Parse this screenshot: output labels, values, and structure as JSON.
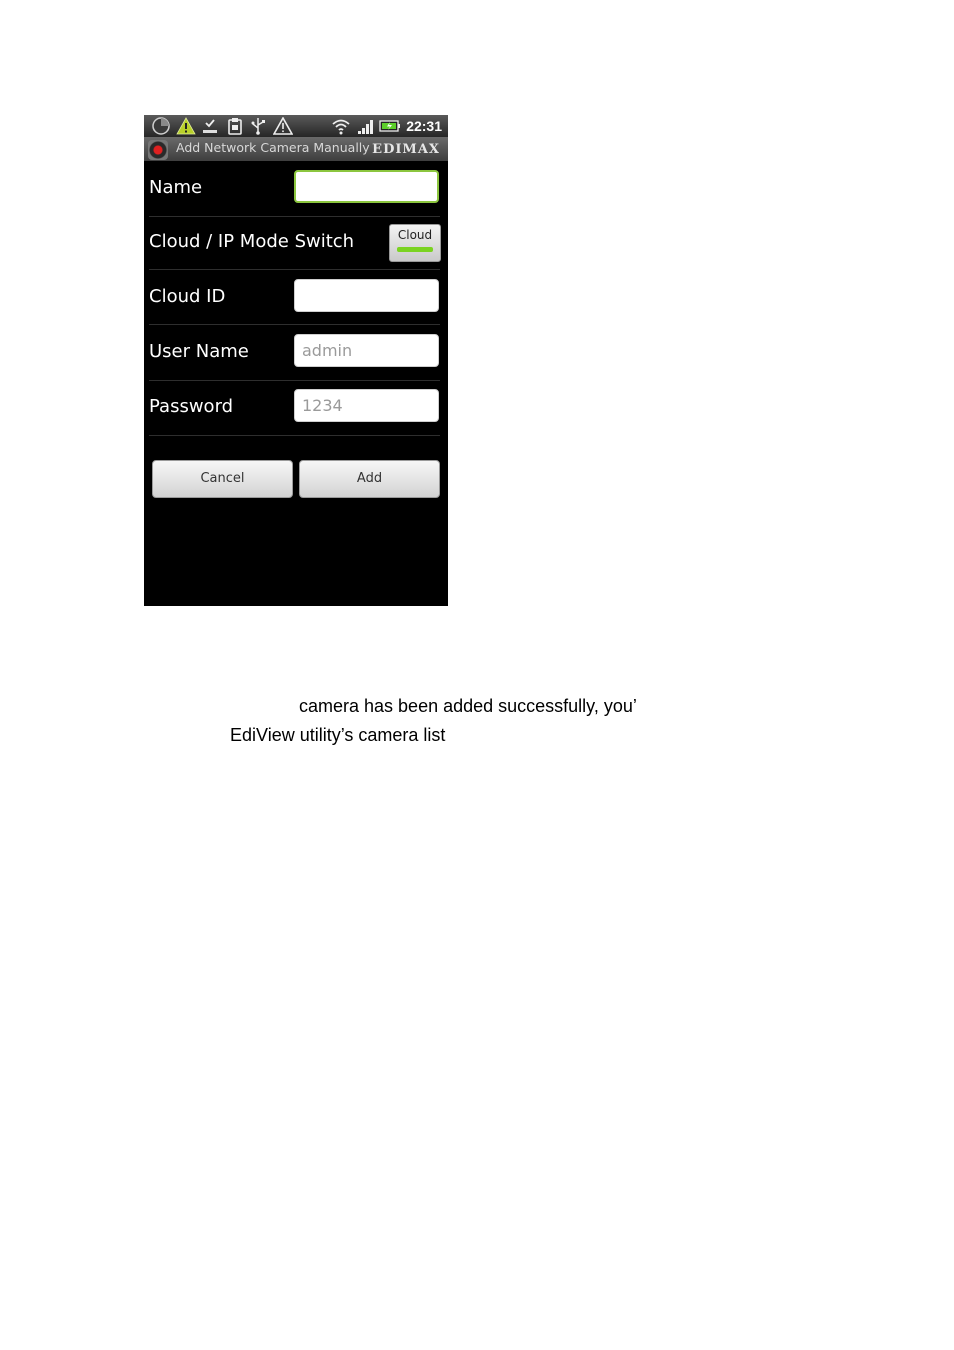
{
  "status_bar": {
    "time": "22:31",
    "icons": [
      "notification-circle-icon",
      "warning-icon",
      "download-icon",
      "clipboard-icon",
      "usb-icon",
      "alert-outline-icon",
      "wifi-icon",
      "signal-icon",
      "battery-icon"
    ]
  },
  "title_bar": {
    "title": "Add Network Camera Manually",
    "brand": "EDIMAX"
  },
  "form": {
    "name_label": "Name",
    "name_value": "",
    "mode_label": "Cloud / IP Mode Switch",
    "mode_toggle_label": "Cloud",
    "cloud_id_label": "Cloud ID",
    "cloud_id_value": "",
    "username_label": "User Name",
    "username_value": "admin",
    "password_label": "Password",
    "password_value": "1234"
  },
  "buttons": {
    "cancel_label": "Cancel",
    "add_label": "Add"
  },
  "document": {
    "line1": "camera has been added successfully, you’",
    "line2": "EdiView utility’s camera list"
  },
  "colors": {
    "focus_green": "#8cc63f",
    "toggle_green": "#7bd321",
    "background": "#000000"
  }
}
